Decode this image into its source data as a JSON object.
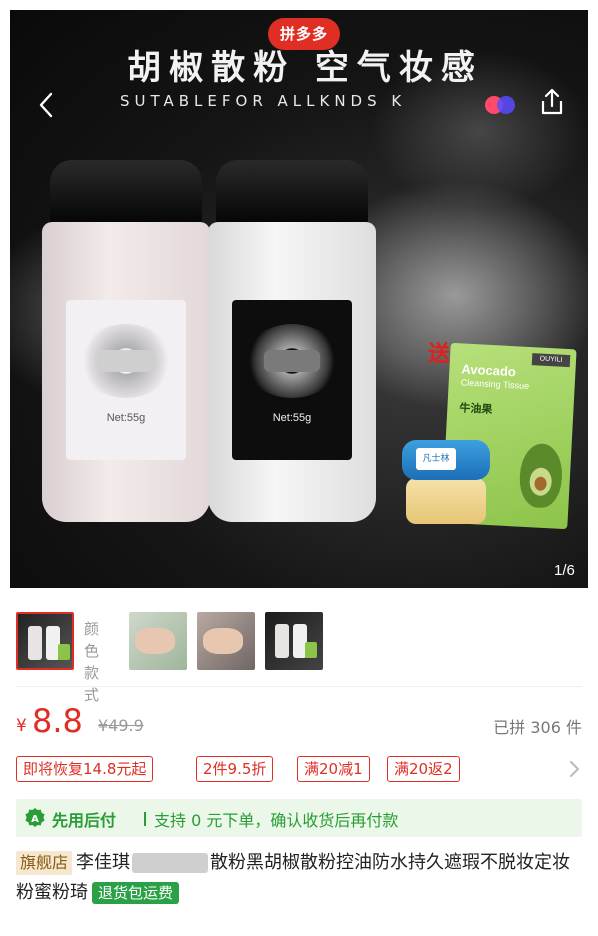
{
  "gallery": {
    "platform_badge": "拼多多",
    "title": "胡椒散粉 空气妆感",
    "subtitle": "SUTABLEFOR ALLKNDS K",
    "net_weight": "Net:55g",
    "gift_label": "送",
    "tissue_title": "Avocado",
    "tissue_subtitle": "Cleansing Tissue",
    "tissue_brand": "OUYILI",
    "tissue_cn": "牛油果",
    "vaseline_label": "凡士林",
    "counter": "1/6"
  },
  "thumbnails": {
    "label": "颜色款式"
  },
  "price": {
    "currency": "¥",
    "current": "8.8",
    "original": "¥49.9",
    "sold": "已拼 306 件"
  },
  "promos": [
    "即将恢复14.8元起",
    "2件9.5折",
    "满20减1",
    "满20返2"
  ],
  "pay_later": {
    "main": "先用后付",
    "sub": "支持 0 元下单，确认收货后再付款"
  },
  "product": {
    "badge": "旗舰店",
    "title_part1": "李佳琪",
    "title_part2": "散粉黑胡椒散粉控油防水持久遮瑕不脱妆定妆粉蜜粉琦",
    "return_badge": "退货包运费"
  },
  "colors": {
    "accent": "#e02e24",
    "green": "#2a9d36",
    "pay_bg": "#eaf7e9"
  }
}
